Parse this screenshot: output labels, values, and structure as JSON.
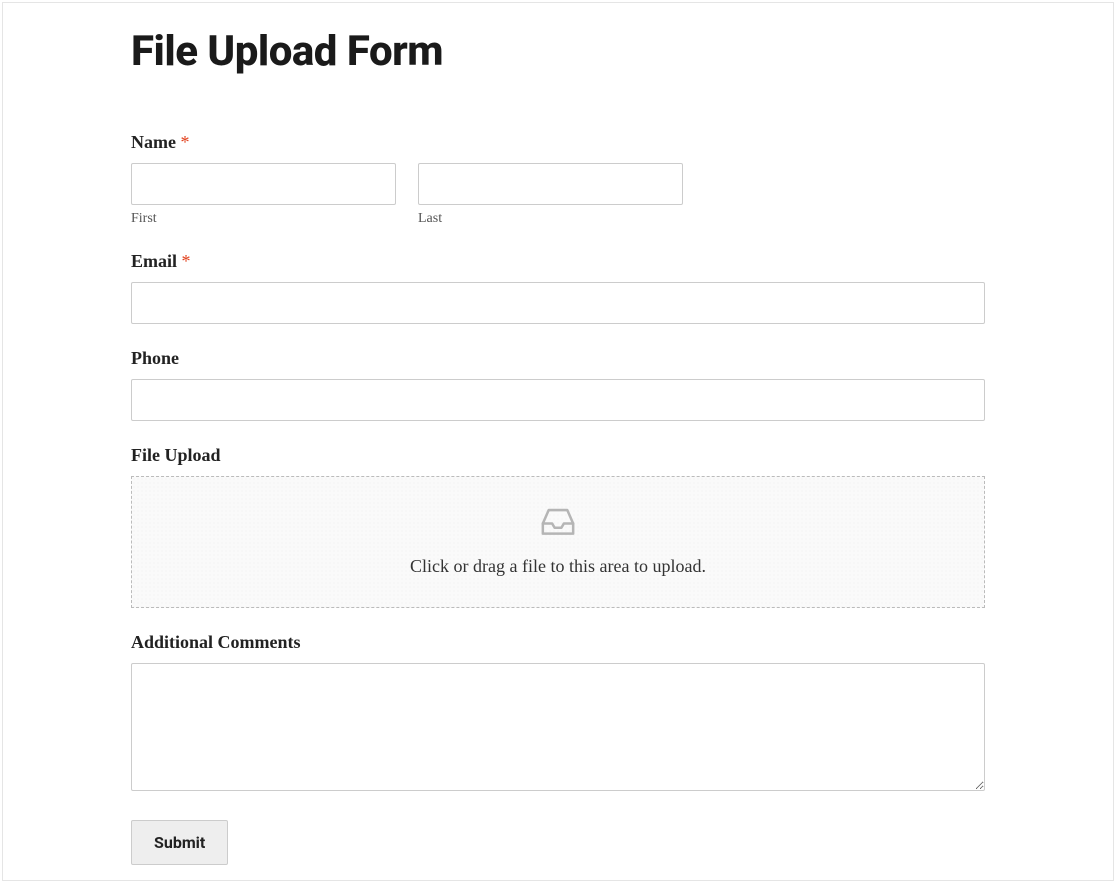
{
  "title": "File Upload Form",
  "required_marker": "*",
  "fields": {
    "name": {
      "label": "Name",
      "required": true,
      "first_sublabel": "First",
      "last_sublabel": "Last"
    },
    "email": {
      "label": "Email",
      "required": true
    },
    "phone": {
      "label": "Phone",
      "required": false
    },
    "file": {
      "label": "File Upload",
      "dropzone_text": "Click or drag a file to this area to upload."
    },
    "comments": {
      "label": "Additional Comments"
    }
  },
  "submit_label": "Submit"
}
